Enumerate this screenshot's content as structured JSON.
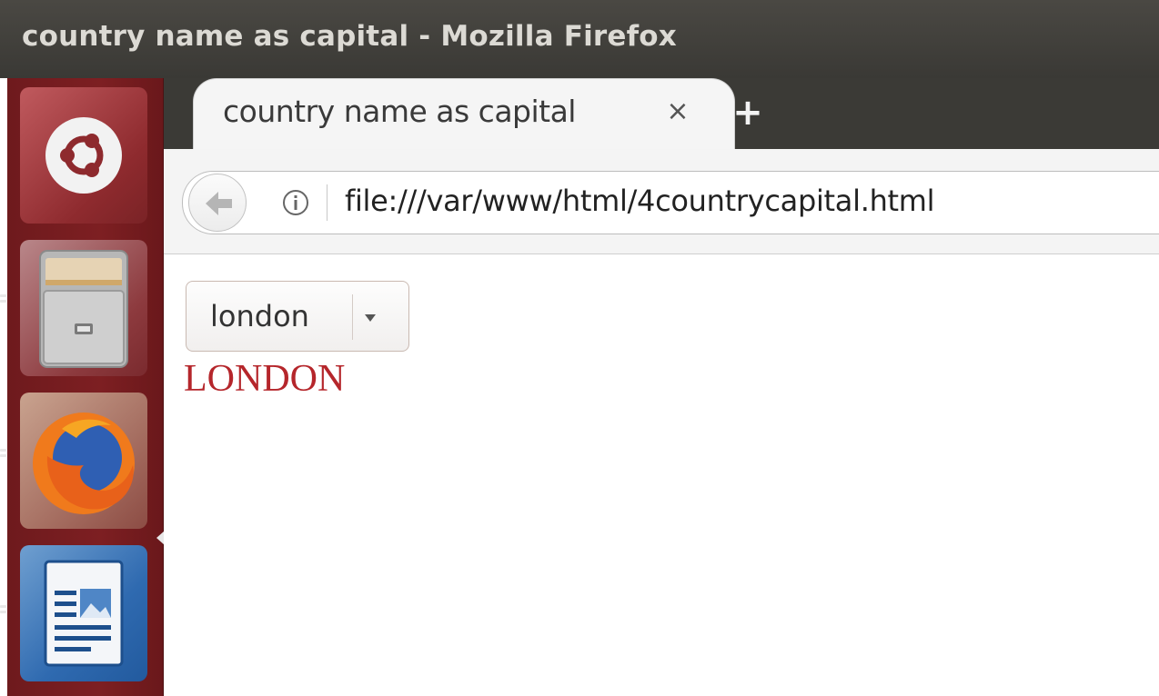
{
  "window": {
    "title": "country name as capital - Mozilla Firefox"
  },
  "launcher": {
    "items": [
      {
        "name": "Ubuntu Dash",
        "icon": "ubuntu-logo-icon"
      },
      {
        "name": "Files",
        "icon": "file-cabinet-icon"
      },
      {
        "name": "Firefox Web Browser",
        "icon": "firefox-icon",
        "active": true
      },
      {
        "name": "LibreOffice Writer",
        "icon": "writer-document-icon"
      }
    ],
    "background_color": "#7d1f22"
  },
  "browser": {
    "tab": {
      "title": "country name as capital",
      "close_glyph": "×"
    },
    "new_tab_glyph": "+",
    "url": "file:///var/www/html/4countrycapital.html"
  },
  "page": {
    "select": {
      "selected": "london"
    },
    "result": "LONDON",
    "result_color": "#b5262b"
  }
}
